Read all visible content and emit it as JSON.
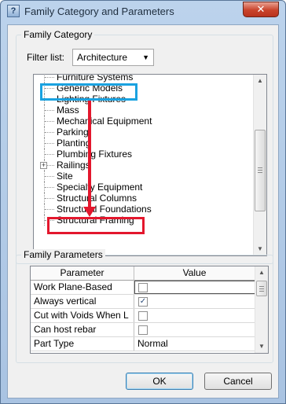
{
  "window": {
    "title": "Family Category and Parameters",
    "app_icon_glyph": "?",
    "close_glyph": "✕"
  },
  "family_category": {
    "group_label": "Family Category",
    "filter_label": "Filter list:",
    "filter_value": "Architecture",
    "items": [
      {
        "label": "Furniture Systems",
        "expandable": false
      },
      {
        "label": "Generic Models",
        "expandable": false
      },
      {
        "label": "Lighting Fixtures",
        "expandable": false
      },
      {
        "label": "Mass",
        "expandable": false
      },
      {
        "label": "Mechanical Equipment",
        "expandable": false
      },
      {
        "label": "Parking",
        "expandable": false
      },
      {
        "label": "Planting",
        "expandable": false
      },
      {
        "label": "Plumbing Fixtures",
        "expandable": false
      },
      {
        "label": "Railings",
        "expandable": true
      },
      {
        "label": "Site",
        "expandable": false
      },
      {
        "label": "Specialty Equipment",
        "expandable": false
      },
      {
        "label": "Structural Columns",
        "expandable": false
      },
      {
        "label": "Structural Foundations",
        "expandable": false
      },
      {
        "label": "Structural Framing",
        "expandable": false
      }
    ]
  },
  "family_parameters": {
    "group_label": "Family Parameters",
    "columns": [
      "Parameter",
      "Value"
    ],
    "rows": [
      {
        "param": "Work Plane-Based",
        "type": "checkbox",
        "checked": false,
        "editing": true
      },
      {
        "param": "Always vertical",
        "type": "checkbox",
        "checked": true
      },
      {
        "param": "Cut with Voids When L",
        "type": "checkbox",
        "checked": false
      },
      {
        "param": "Can host rebar",
        "type": "checkbox",
        "checked": false
      },
      {
        "param": "Part Type",
        "type": "text",
        "value": "Normal"
      }
    ]
  },
  "buttons": {
    "ok": "OK",
    "cancel": "Cancel"
  },
  "glyphs": {
    "expand": "+",
    "scroll_up": "▲",
    "scroll_down": "▼",
    "dropdown": "▼",
    "check": "✓"
  },
  "colors": {
    "annotation_blue": "#1aa2e0",
    "annotation_red": "#e3172d"
  }
}
